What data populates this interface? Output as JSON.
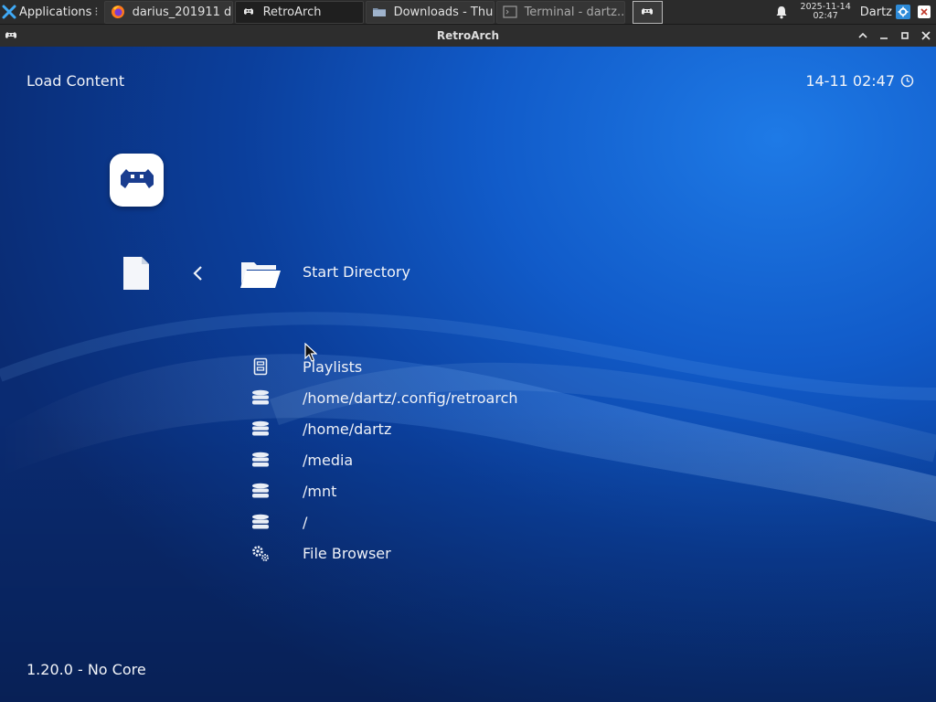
{
  "taskbar": {
    "applications_label": "Applications",
    "tasks": [
      {
        "label": "darius_201911 d...",
        "icon": "firefox-icon"
      },
      {
        "label": "RetroArch",
        "icon": "retroarch-icon"
      },
      {
        "label": "Downloads - Thu...",
        "icon": "folder-icon"
      },
      {
        "label": "Terminal - dartz...",
        "icon": "terminal-icon"
      }
    ],
    "clock_date": "2025-11-14",
    "clock_time": "02:47",
    "user": "Dartz"
  },
  "window": {
    "title": "RetroArch"
  },
  "retroarch": {
    "header_title": "Load Content",
    "clock": "14-11 02:47",
    "category_label": "Start Directory",
    "footer": "1.20.0 - No Core",
    "items": [
      {
        "label": "Playlists",
        "icon": "playlist-icon"
      },
      {
        "label": "/home/dartz/.config/retroarch",
        "icon": "drive-icon"
      },
      {
        "label": "/home/dartz",
        "icon": "drive-icon"
      },
      {
        "label": "/media",
        "icon": "drive-icon"
      },
      {
        "label": "/mnt",
        "icon": "drive-icon"
      },
      {
        "label": "/",
        "icon": "drive-icon"
      },
      {
        "label": "File Browser",
        "icon": "settings-icon"
      }
    ]
  },
  "colors": {
    "background_accent": "#115bc9",
    "taskbar": "#2b2b2b"
  }
}
